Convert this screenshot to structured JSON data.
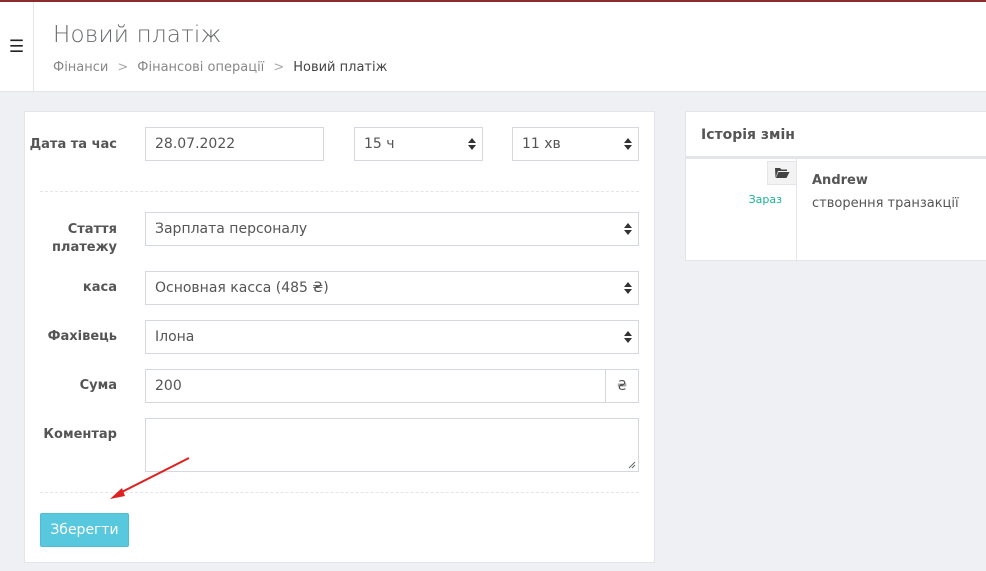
{
  "header": {
    "title": "Новий платіж",
    "breadcrumb": [
      "Фінанси",
      "Фінансові операції",
      "Новий платіж"
    ],
    "breadcrumb_separator": ">"
  },
  "form": {
    "datetime": {
      "label": "Дата та час",
      "date_value": "28.07.2022",
      "hour_value": "15 ч",
      "minute_value": "11 хв"
    },
    "article": {
      "label": "Стаття платежу",
      "value": "Зарплата персоналу"
    },
    "cashbox": {
      "label": "каса",
      "value": "Основная касса (485 ₴)"
    },
    "specialist": {
      "label": "Фахівець",
      "value": "Ілона"
    },
    "amount": {
      "label": "Сума",
      "value": "200",
      "currency": "₴"
    },
    "comment": {
      "label": "Коментар",
      "value": ""
    },
    "save_label": "Зберегти"
  },
  "history": {
    "title": "Історія змін",
    "entries": [
      {
        "time": "Зараз",
        "user": "Andrew",
        "action": "створення транзакції"
      }
    ]
  },
  "colors": {
    "accent_button": "#57c8de",
    "time_green": "#1ab394",
    "annotation_arrow": "#e02020"
  }
}
